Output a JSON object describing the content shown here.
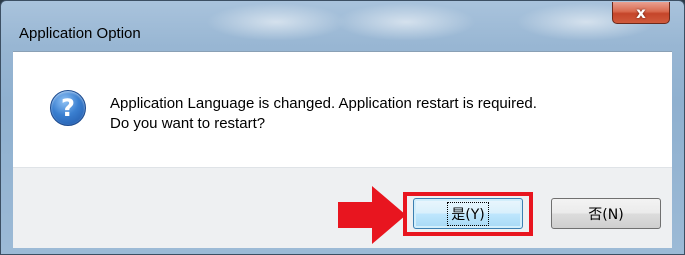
{
  "dialog": {
    "title": "Application Option",
    "close_glyph": "x",
    "icon": "question-icon",
    "icon_glyph": "?",
    "message_line1": "Application Language is changed. Application restart is required.",
    "message_line2": "Do you want to restart?"
  },
  "buttons": {
    "yes_label": "是(Y)",
    "no_label": "否(N)"
  },
  "annotation": {
    "highlight_color": "#e8151f",
    "arrow_color": "#e8151f"
  }
}
